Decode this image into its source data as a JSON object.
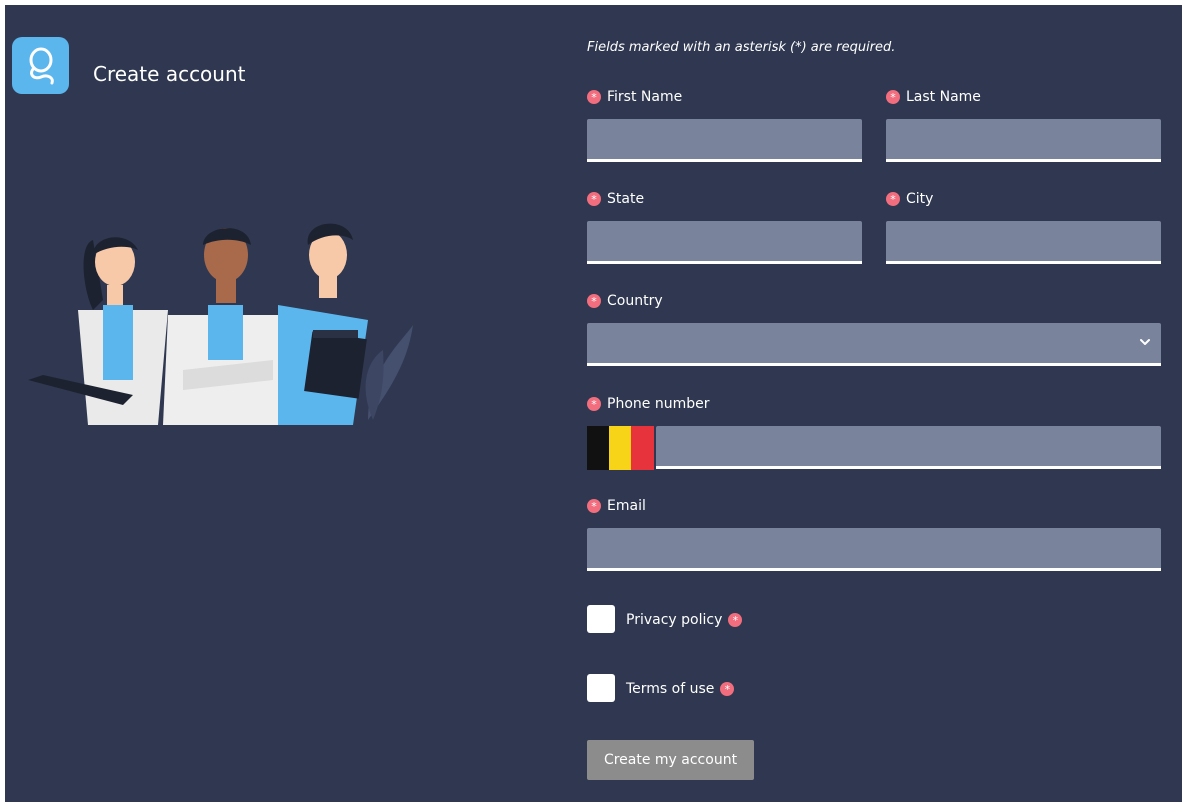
{
  "header": {
    "title": "Create account",
    "logo_icon": "app-logo-icon"
  },
  "form": {
    "required_note": "Fields marked with an asterisk (*) are required.",
    "required_mark": "*",
    "first_name": {
      "label": "First Name",
      "value": ""
    },
    "last_name": {
      "label": "Last Name",
      "value": ""
    },
    "state": {
      "label": "State",
      "value": ""
    },
    "city": {
      "label": "City",
      "value": ""
    },
    "country": {
      "label": "Country",
      "value": ""
    },
    "phone": {
      "label": "Phone number",
      "value": "",
      "flag": "belgium-flag-icon"
    },
    "email": {
      "label": "Email",
      "value": ""
    },
    "privacy": {
      "label": "Privacy policy",
      "checked": false
    },
    "terms": {
      "label": "Terms of use",
      "checked": false
    },
    "submit_label": "Create my account"
  },
  "colors": {
    "background": "#2f3850",
    "field": "#7a839c",
    "required": "#f26d7d",
    "logo": "#5bb6ee",
    "button": "#8c8c8c"
  }
}
